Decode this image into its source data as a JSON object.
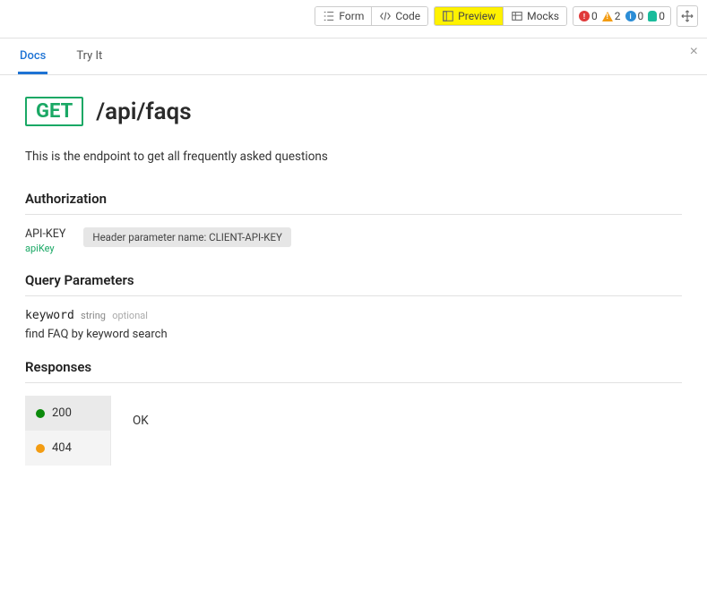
{
  "toolbar": {
    "form": "Form",
    "code": "Code",
    "preview": "Preview",
    "mocks": "Mocks",
    "indicators": {
      "error_count": "0",
      "warn_count": "2",
      "info_count": "0",
      "hint_count": "0"
    }
  },
  "tabs": {
    "docs": "Docs",
    "tryit": "Try It"
  },
  "api": {
    "method": "GET",
    "path": "/api/faqs",
    "description": "This is the endpoint to get all frequently asked questions"
  },
  "auth": {
    "heading": "Authorization",
    "name": "API-KEY",
    "type": "apiKey",
    "desc": "Header parameter name: CLIENT-API-KEY"
  },
  "query": {
    "heading": "Query Parameters",
    "param_name": "keyword",
    "param_type": "string",
    "param_opt": "optional",
    "param_desc": "find FAQ by keyword search"
  },
  "responses": {
    "heading": "Responses",
    "items": [
      {
        "code": "200",
        "color": "green"
      },
      {
        "code": "404",
        "color": "orange"
      }
    ],
    "selected_body": "OK"
  }
}
